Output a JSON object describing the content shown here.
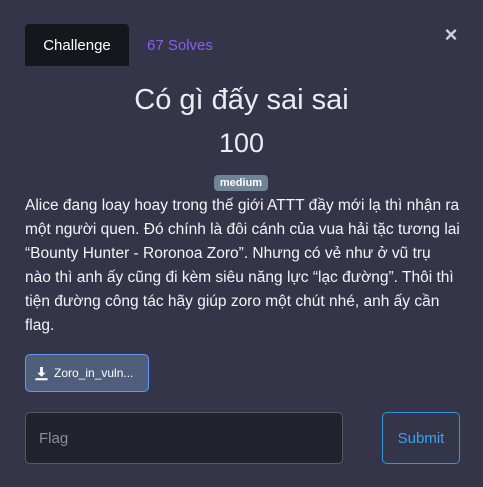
{
  "tabs": {
    "challenge": "Challenge",
    "solves": "67 Solves"
  },
  "close_icon": "×",
  "challenge": {
    "title": "Có gì đấy sai sai",
    "value": "100",
    "difficulty": "medium",
    "description": "Alice đang loay hoay trong thế giới ATTT đầy mới lạ thì nhận ra một người quen. Đó chính là đôi cánh của vua hải tặc tương lai “Bounty Hunter - Roronoa Zoro”. Nhưng có vẻ như ở vũ trụ nào thì anh ấy cũng đi kèm siêu năng lực “lạc đường”. Thôi thì tiện đường công tác hãy giúp zoro một chút nhé, anh ấy cần flag.",
    "file_label": "Zoro_in_vuln..."
  },
  "form": {
    "flag_placeholder": "Flag",
    "submit_label": "Submit"
  },
  "colors": {
    "background": "#35354a",
    "tab_active": "#16161d",
    "solves_link": "#8a5cf6",
    "badge": "#6f8597",
    "submit": "#3aa3eb"
  }
}
